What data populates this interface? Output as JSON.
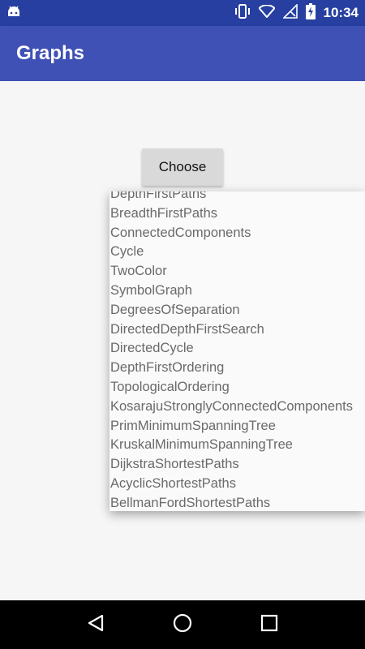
{
  "status_bar": {
    "time": "10:34",
    "icons": [
      "android-icon",
      "vibrate-icon",
      "wifi-icon",
      "no-signal-icon",
      "battery-charging-icon"
    ]
  },
  "app_bar": {
    "title": "Graphs"
  },
  "main": {
    "choose_label": "Choose"
  },
  "menu": {
    "items": [
      "DepthFirstPaths",
      "BreadthFirstPaths",
      "ConnectedComponents",
      "Cycle",
      "TwoColor",
      "SymbolGraph",
      "DegreesOfSeparation",
      "DirectedDepthFirstSearch",
      "DirectedCycle",
      "DepthFirstOrdering",
      "TopologicalOrdering",
      "KosarajuStronglyConnectedComponents",
      "PrimMinimumSpanningTree",
      "KruskalMinimumSpanningTree",
      "DijkstraShortestPaths",
      "AcyclicShortestPaths",
      "BellmanFordShortestPaths"
    ]
  },
  "nav_bar": {
    "icons": [
      "back-icon",
      "home-icon",
      "recents-icon"
    ]
  },
  "colors": {
    "status_bar": "#263fa0",
    "app_bar": "#3f51b5",
    "background": "#f6f6f6"
  }
}
